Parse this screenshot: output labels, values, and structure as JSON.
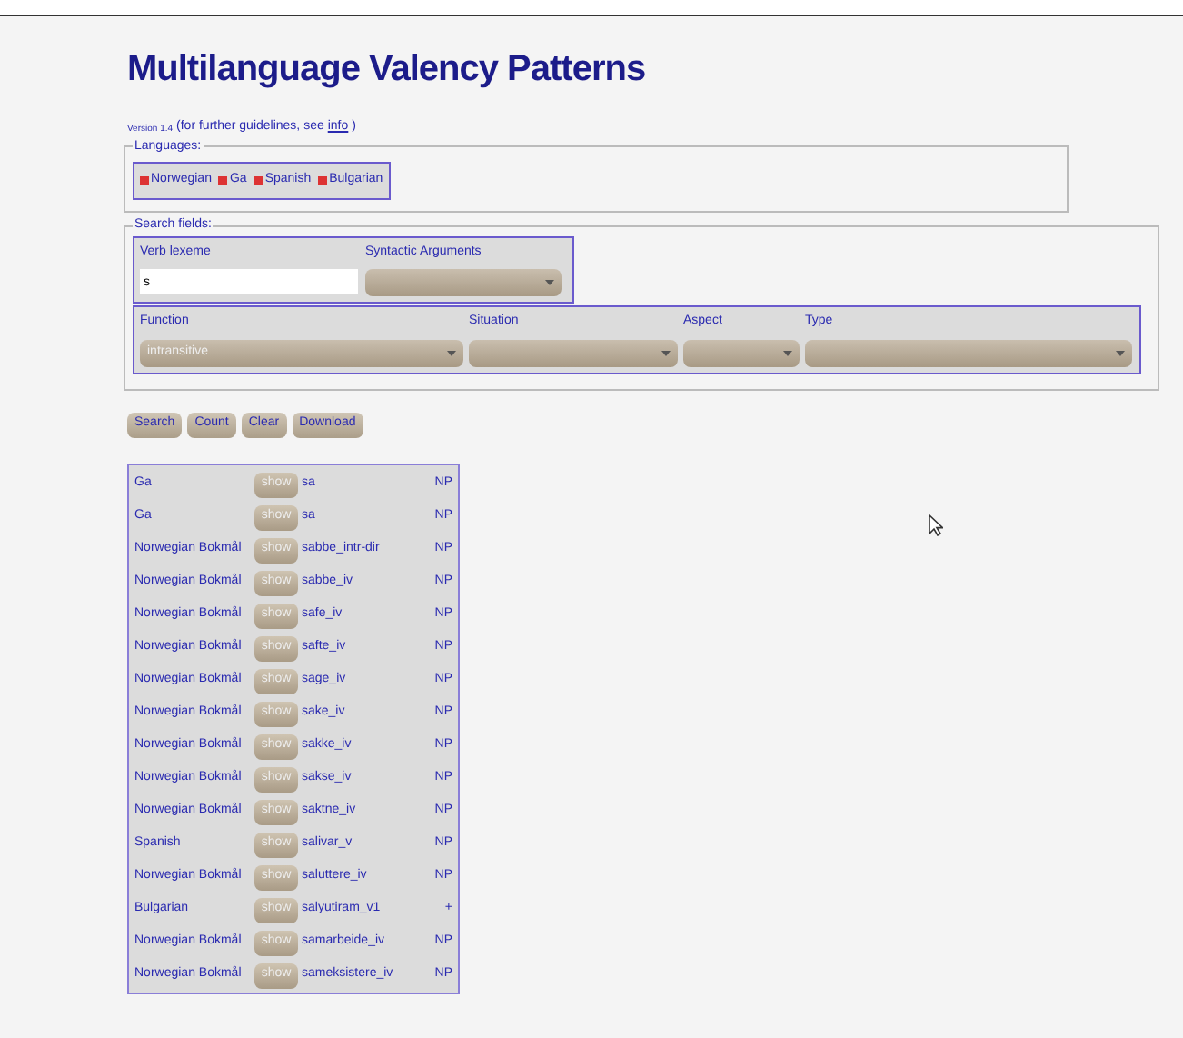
{
  "title": "Multilanguage Valency Patterns",
  "version": {
    "label": "Version 1.4",
    "note": "(for further guidelines, see",
    "link": "info",
    "close": ")"
  },
  "languages": {
    "legend": "Languages:",
    "items": [
      {
        "label": "Norwegian",
        "checked": true
      },
      {
        "label": "Ga",
        "checked": true
      },
      {
        "label": "Spanish",
        "checked": true
      },
      {
        "label": "Bulgarian",
        "checked": true
      }
    ]
  },
  "search_fields": {
    "legend": "Search fields:",
    "verb_lexeme": {
      "label": "Verb lexeme",
      "value": "s"
    },
    "syntactic_arguments": {
      "label": "Syntactic Arguments"
    },
    "selects": [
      {
        "label": "Function",
        "value": "intransitive"
      },
      {
        "label": "Situation"
      },
      {
        "label": "Aspect"
      },
      {
        "label": "Type"
      }
    ]
  },
  "buttons": [
    "Search",
    "Count",
    "Clear",
    "Download"
  ],
  "results": [
    {
      "language": "Ga",
      "action": "show",
      "lexeme": "sa",
      "frame": "NP"
    },
    {
      "language": "Ga",
      "action": "show",
      "lexeme": "sa",
      "frame": "NP"
    },
    {
      "language": "Norwegian Bokmål",
      "action": "show",
      "lexeme": "sabbe_intr-dir",
      "frame": "NP"
    },
    {
      "language": "Norwegian Bokmål",
      "action": "show",
      "lexeme": "sabbe_iv",
      "frame": "NP"
    },
    {
      "language": "Norwegian Bokmål",
      "action": "show",
      "lexeme": "safe_iv",
      "frame": "NP"
    },
    {
      "language": "Norwegian Bokmål",
      "action": "show",
      "lexeme": "safte_iv",
      "frame": "NP"
    },
    {
      "language": "Norwegian Bokmål",
      "action": "show",
      "lexeme": "sage_iv",
      "frame": "NP"
    },
    {
      "language": "Norwegian Bokmål",
      "action": "show",
      "lexeme": "sake_iv",
      "frame": "NP"
    },
    {
      "language": "Norwegian Bokmål",
      "action": "show",
      "lexeme": "sakke_iv",
      "frame": "NP"
    },
    {
      "language": "Norwegian Bokmål",
      "action": "show",
      "lexeme": "sakse_iv",
      "frame": "NP"
    },
    {
      "language": "Norwegian Bokmål",
      "action": "show",
      "lexeme": "saktne_iv",
      "frame": "NP"
    },
    {
      "language": "Spanish",
      "action": "show",
      "lexeme": "salivar_v",
      "frame": "NP"
    },
    {
      "language": "Norwegian Bokmål",
      "action": "show",
      "lexeme": "saluttere_iv",
      "frame": "NP"
    },
    {
      "language": "Bulgarian",
      "action": "show",
      "lexeme": "salyutiram_v1",
      "frame": "+"
    },
    {
      "language": "Norwegian Bokmål",
      "action": "show",
      "lexeme": "samarbeide_iv",
      "frame": "NP"
    },
    {
      "language": "Norwegian Bokmål",
      "action": "show",
      "lexeme": "sameksistere_iv",
      "frame": "NP"
    }
  ]
}
